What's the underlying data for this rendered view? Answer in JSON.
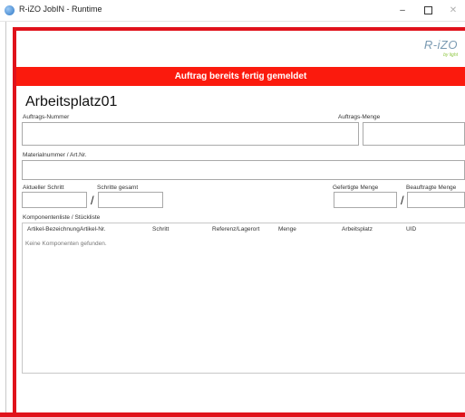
{
  "window": {
    "title": "R-iZO JobIN - Runtime",
    "min_glyph": "–",
    "close_glyph": "✕"
  },
  "logo": {
    "brand": "R-iZO",
    "tagline": "by light"
  },
  "banner": {
    "text": "Auftrag bereits fertig gemeldet",
    "color": "#fb1a0d"
  },
  "workstation": {
    "title": "Arbeitsplatz01"
  },
  "fields": {
    "order_number": {
      "label": "Auftrags-Nummer",
      "value": ""
    },
    "order_quantity": {
      "label": "Auftrags-Menge",
      "value": ""
    },
    "material_number": {
      "label": "Materialnummer / Art.Nr.",
      "value": ""
    },
    "current_step": {
      "label": "Aktueller Schritt",
      "value": ""
    },
    "total_steps": {
      "label": "Schritte gesamt",
      "value": ""
    },
    "produced_quantity": {
      "label": "Gefertigte Menge",
      "value": ""
    },
    "ordered_quantity": {
      "label": "Beauftragte Menge",
      "value": ""
    },
    "separator": "/"
  },
  "components": {
    "label": "Komponentenliste / Stückliste",
    "columns": [
      "Artikel-Bezeichnung",
      "Artikel-Nr.",
      "Schritt",
      "Referenz/Lagerort",
      "Menge",
      "Arbeitsplatz",
      "UID"
    ],
    "empty_text": "Keine Komponenten gefunden."
  },
  "colors": {
    "accent": "#e0121b"
  }
}
